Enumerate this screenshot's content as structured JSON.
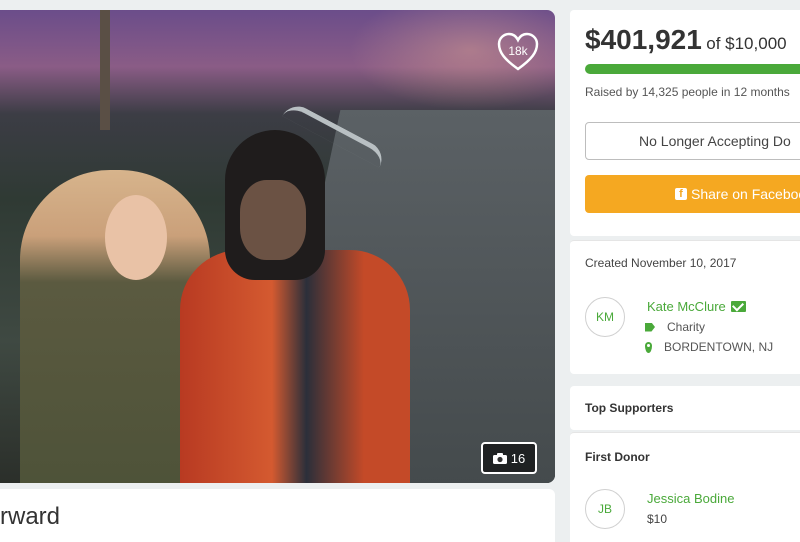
{
  "campaign": {
    "title_fragment": "rward",
    "photo_likes": "18k",
    "photo_count": "16"
  },
  "donation": {
    "amount_raised": "$401,921",
    "goal": "of $10,000",
    "progress_percent": 100,
    "raised_by": "Raised by 14,325 people in 12 months",
    "closed_button_label": "No Longer Accepting Do",
    "share_button_label": "Share on Faceboo"
  },
  "organizer": {
    "created": "Created November 10, 2017",
    "initials": "KM",
    "name": "Kate McClure",
    "category": "Charity",
    "location": "BORDENTOWN, NJ"
  },
  "supporters": {
    "top_label": "Top Supporters",
    "first_donor_label": "First Donor",
    "first_donor_initials": "JB",
    "first_donor_name": "Jessica Bodine",
    "first_donor_amount": "$10"
  },
  "colors": {
    "accent_green": "#4aa93a",
    "share_orange": "#f5a821"
  },
  "icons": [
    "heart-icon",
    "camera-icon",
    "facebook-icon",
    "mail-icon",
    "tag-icon",
    "map-pin-icon"
  ]
}
